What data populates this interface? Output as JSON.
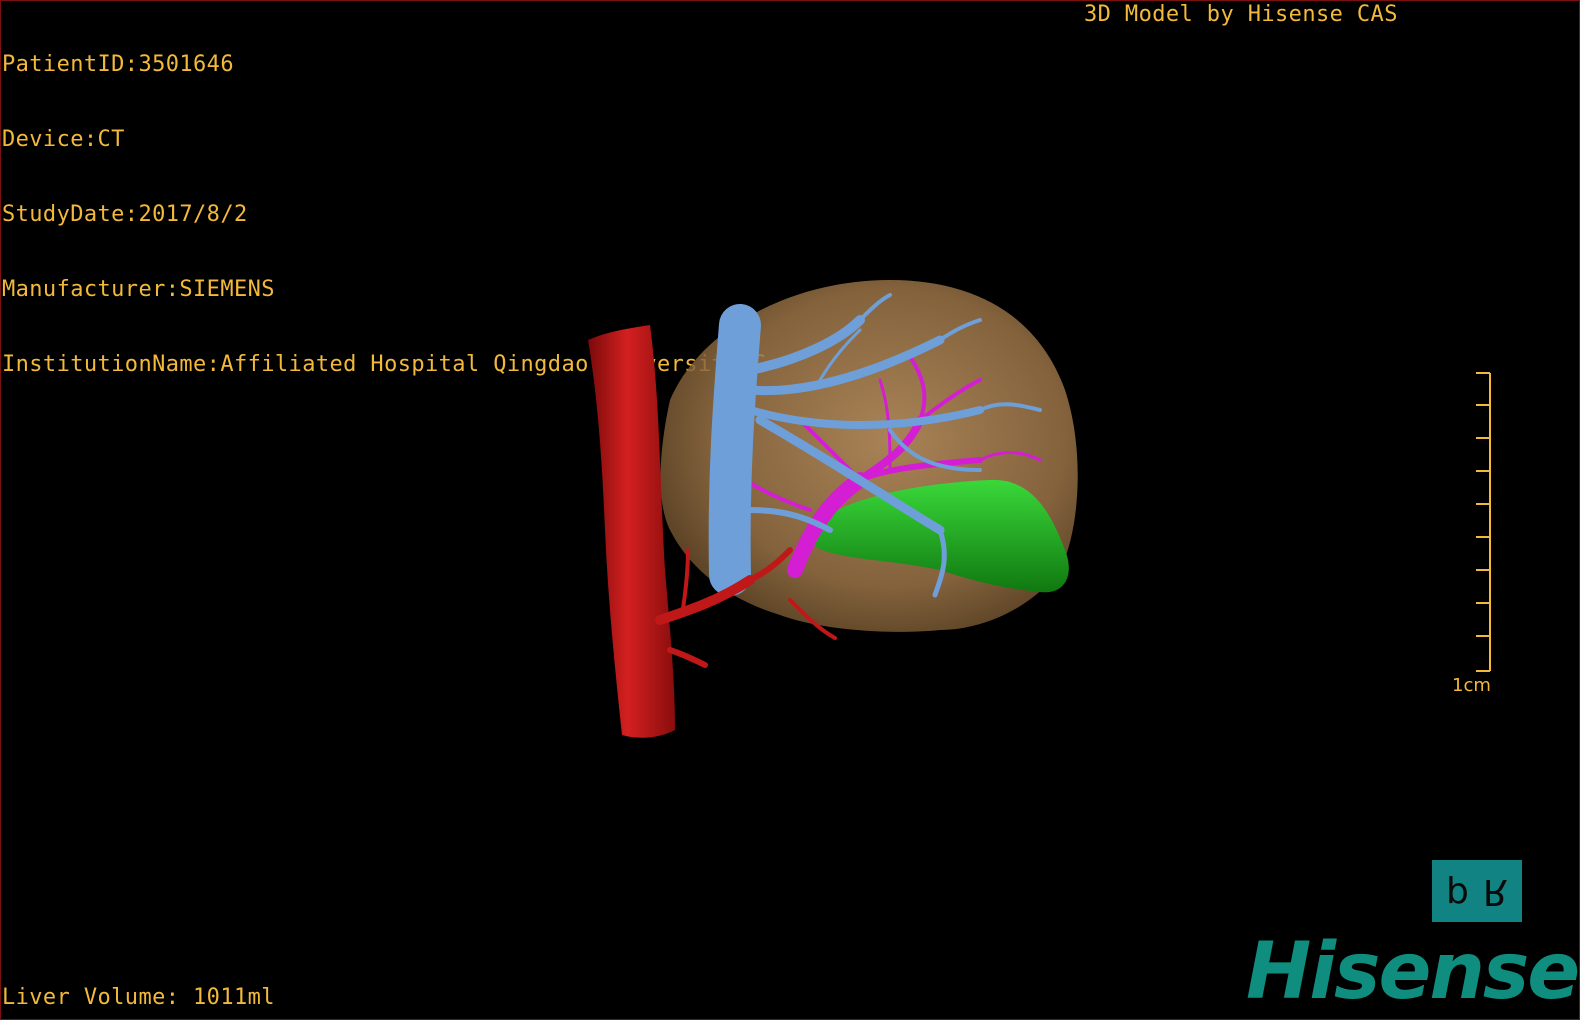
{
  "overlay": {
    "patient_id": "PatientID:3501646",
    "device": "Device:CT",
    "study_date": "StudyDate:2017/8/2",
    "manufacturer": "Manufacturer:SIEMENS",
    "institution": "InstitutionName:Affiliated Hospital Qingdao University-C",
    "model_credit": "3D Model by Hisense CAS",
    "liver_volume": "Liver Volume: 1011ml"
  },
  "scale": {
    "label": "1cm"
  },
  "orientation": {
    "left_glyph": "d",
    "right_glyph": "R"
  },
  "brand": {
    "logo_text": "Hisense"
  },
  "colors": {
    "overlay_text": "#f2b93a",
    "liver": "#b48a5a",
    "artery": "#c01818",
    "vein_blue": "#6f9fd8",
    "portal_magenta": "#d41ed4",
    "green_structure": "#1fa81f",
    "brand_teal": "#0f8e7f"
  }
}
